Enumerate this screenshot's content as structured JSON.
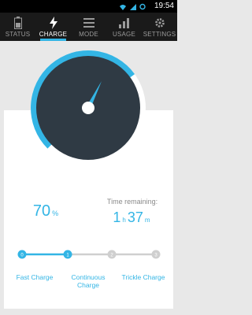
{
  "status_bar": {
    "time": "19:54"
  },
  "tabs": [
    {
      "label": "STATUS",
      "icon": "battery-icon"
    },
    {
      "label": "CHARGE",
      "icon": "lightning-icon",
      "active": true
    },
    {
      "label": "MODE",
      "icon": "list-icon"
    },
    {
      "label": "USAGE",
      "icon": "bar-chart-icon"
    },
    {
      "label": "SETTINGS",
      "icon": "gear-icon"
    }
  ],
  "charge": {
    "percent": "70",
    "percent_unit": "%",
    "gauge_level": 0.7,
    "time_remaining_label": "Time remaining:",
    "hours": "1",
    "hours_unit": "h",
    "minutes": "37",
    "minutes_unit": "m"
  },
  "stages": [
    {
      "num": "0",
      "label": "Fast Charge"
    },
    {
      "num": "1",
      "label": "Continuous Charge"
    },
    {
      "num": "2",
      "label": "Trickle Charge"
    },
    {
      "num": "3",
      "label": ""
    }
  ],
  "colors": {
    "accent": "#33b5e5",
    "dial": "#2f3a44",
    "tabbar": "#1a1a1a"
  }
}
